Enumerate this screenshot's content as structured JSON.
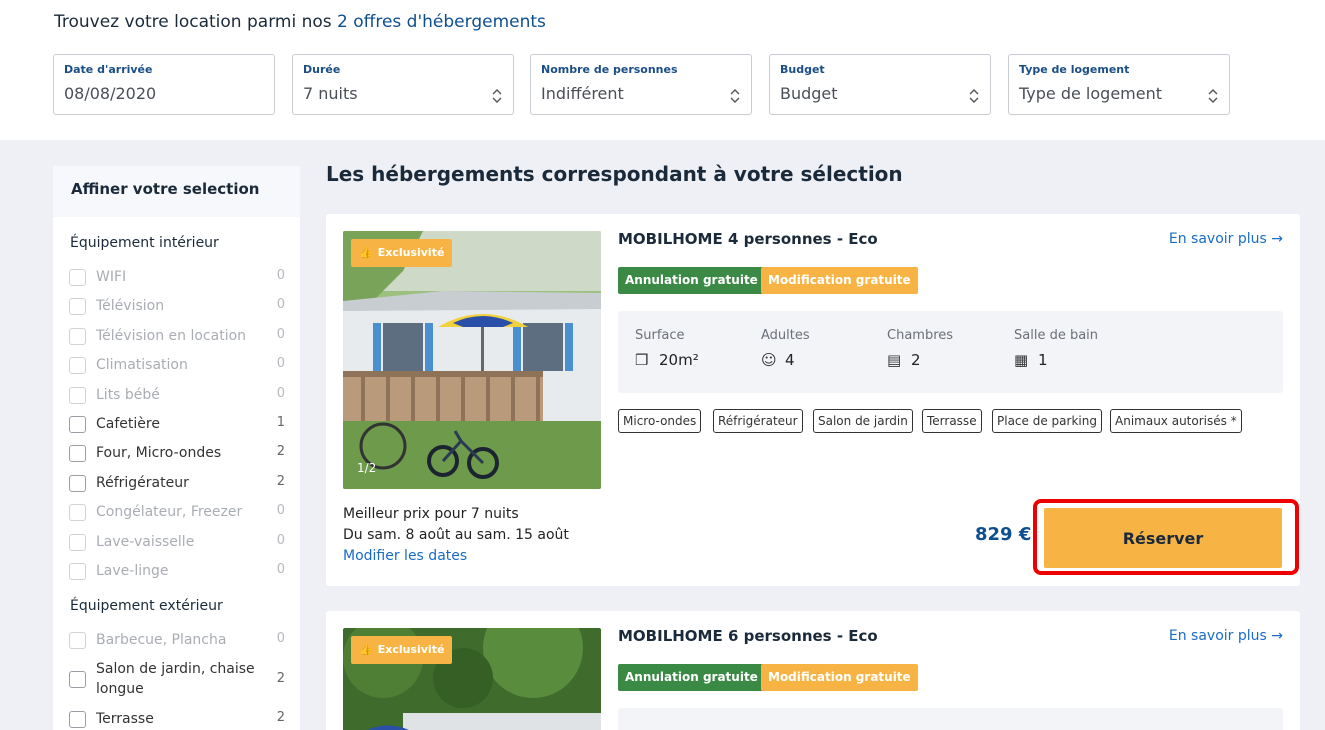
{
  "header": {
    "title_prefix": "Trouvez votre location parmi nos",
    "title_accent": "2 offres d'hébergements",
    "fields": [
      {
        "label": "Date d'arrivée",
        "value": "08/08/2020"
      },
      {
        "label": "Durée",
        "value": "7 nuits"
      },
      {
        "label": "Nombre de personnes",
        "value": "Indifférent"
      },
      {
        "label": "Budget",
        "value": "Budget"
      },
      {
        "label": "Type de logement",
        "value": "Type de logement"
      }
    ]
  },
  "sidebar": {
    "title": "Affiner votre selection",
    "sections": [
      {
        "title": "Équipement intérieur",
        "items": [
          {
            "label": "WIFI",
            "count": "0",
            "disabled": true
          },
          {
            "label": "Télévision",
            "count": "0",
            "disabled": true
          },
          {
            "label": "Télévision en location",
            "count": "0",
            "disabled": true
          },
          {
            "label": "Climatisation",
            "count": "0",
            "disabled": true
          },
          {
            "label": "Lits bébé",
            "count": "0",
            "disabled": true
          },
          {
            "label": "Cafetière",
            "count": "1",
            "disabled": false
          },
          {
            "label": "Four, Micro-ondes",
            "count": "2",
            "disabled": false
          },
          {
            "label": "Réfrigérateur",
            "count": "2",
            "disabled": false
          },
          {
            "label": "Congélateur, Freezer",
            "count": "0",
            "disabled": true
          },
          {
            "label": "Lave-vaisselle",
            "count": "0",
            "disabled": true
          },
          {
            "label": "Lave-linge",
            "count": "0",
            "disabled": true
          }
        ]
      },
      {
        "title": "Équipement extérieur",
        "items": [
          {
            "label": "Barbecue, Plancha",
            "count": "0",
            "disabled": true
          },
          {
            "label": "Salon de jardin, chaise longue",
            "count": "2",
            "disabled": false
          },
          {
            "label": "Terrasse",
            "count": "2",
            "disabled": false
          }
        ]
      }
    ]
  },
  "results": {
    "title": "Les hébergements correspondant à votre sélection",
    "cards": [
      {
        "badge": "Exclusivité",
        "pager": "1/2",
        "title": "MOBILHOME 4 personnes - Eco",
        "more": "En savoir plus →",
        "tags": [
          "Annulation gratuite",
          "Modification gratuite"
        ],
        "specs": [
          {
            "label": "Surface",
            "value": "20m²",
            "icon": "surface-icon"
          },
          {
            "label": "Adultes",
            "value": "4",
            "icon": "person-icon"
          },
          {
            "label": "Chambres",
            "value": "2",
            "icon": "bed-icon"
          },
          {
            "label": "Salle de bain",
            "value": "1",
            "icon": "shower-icon"
          }
        ],
        "chips": [
          "Micro-ondes",
          "Réfrigérateur",
          "Salon de jardin",
          "Terrasse",
          "Place de parking",
          "Animaux autorisés *"
        ],
        "best_price": "Meilleur prix pour 7 nuits",
        "dates": "Du sam. 8 août au sam. 15 août",
        "modify": "Modifier les dates",
        "price": "829 €",
        "reserve": "Réserver"
      },
      {
        "badge": "Exclusivité",
        "title": "MOBILHOME 6 personnes - Eco",
        "more": "En savoir plus →",
        "tags": [
          "Annulation gratuite",
          "Modification gratuite"
        ]
      }
    ]
  },
  "colors": {
    "accent_blue": "#0e4f8f",
    "link_blue": "#1a6cc4",
    "orange": "#f7b445",
    "green": "#3a8a46",
    "highlight_red": "#e00000"
  }
}
